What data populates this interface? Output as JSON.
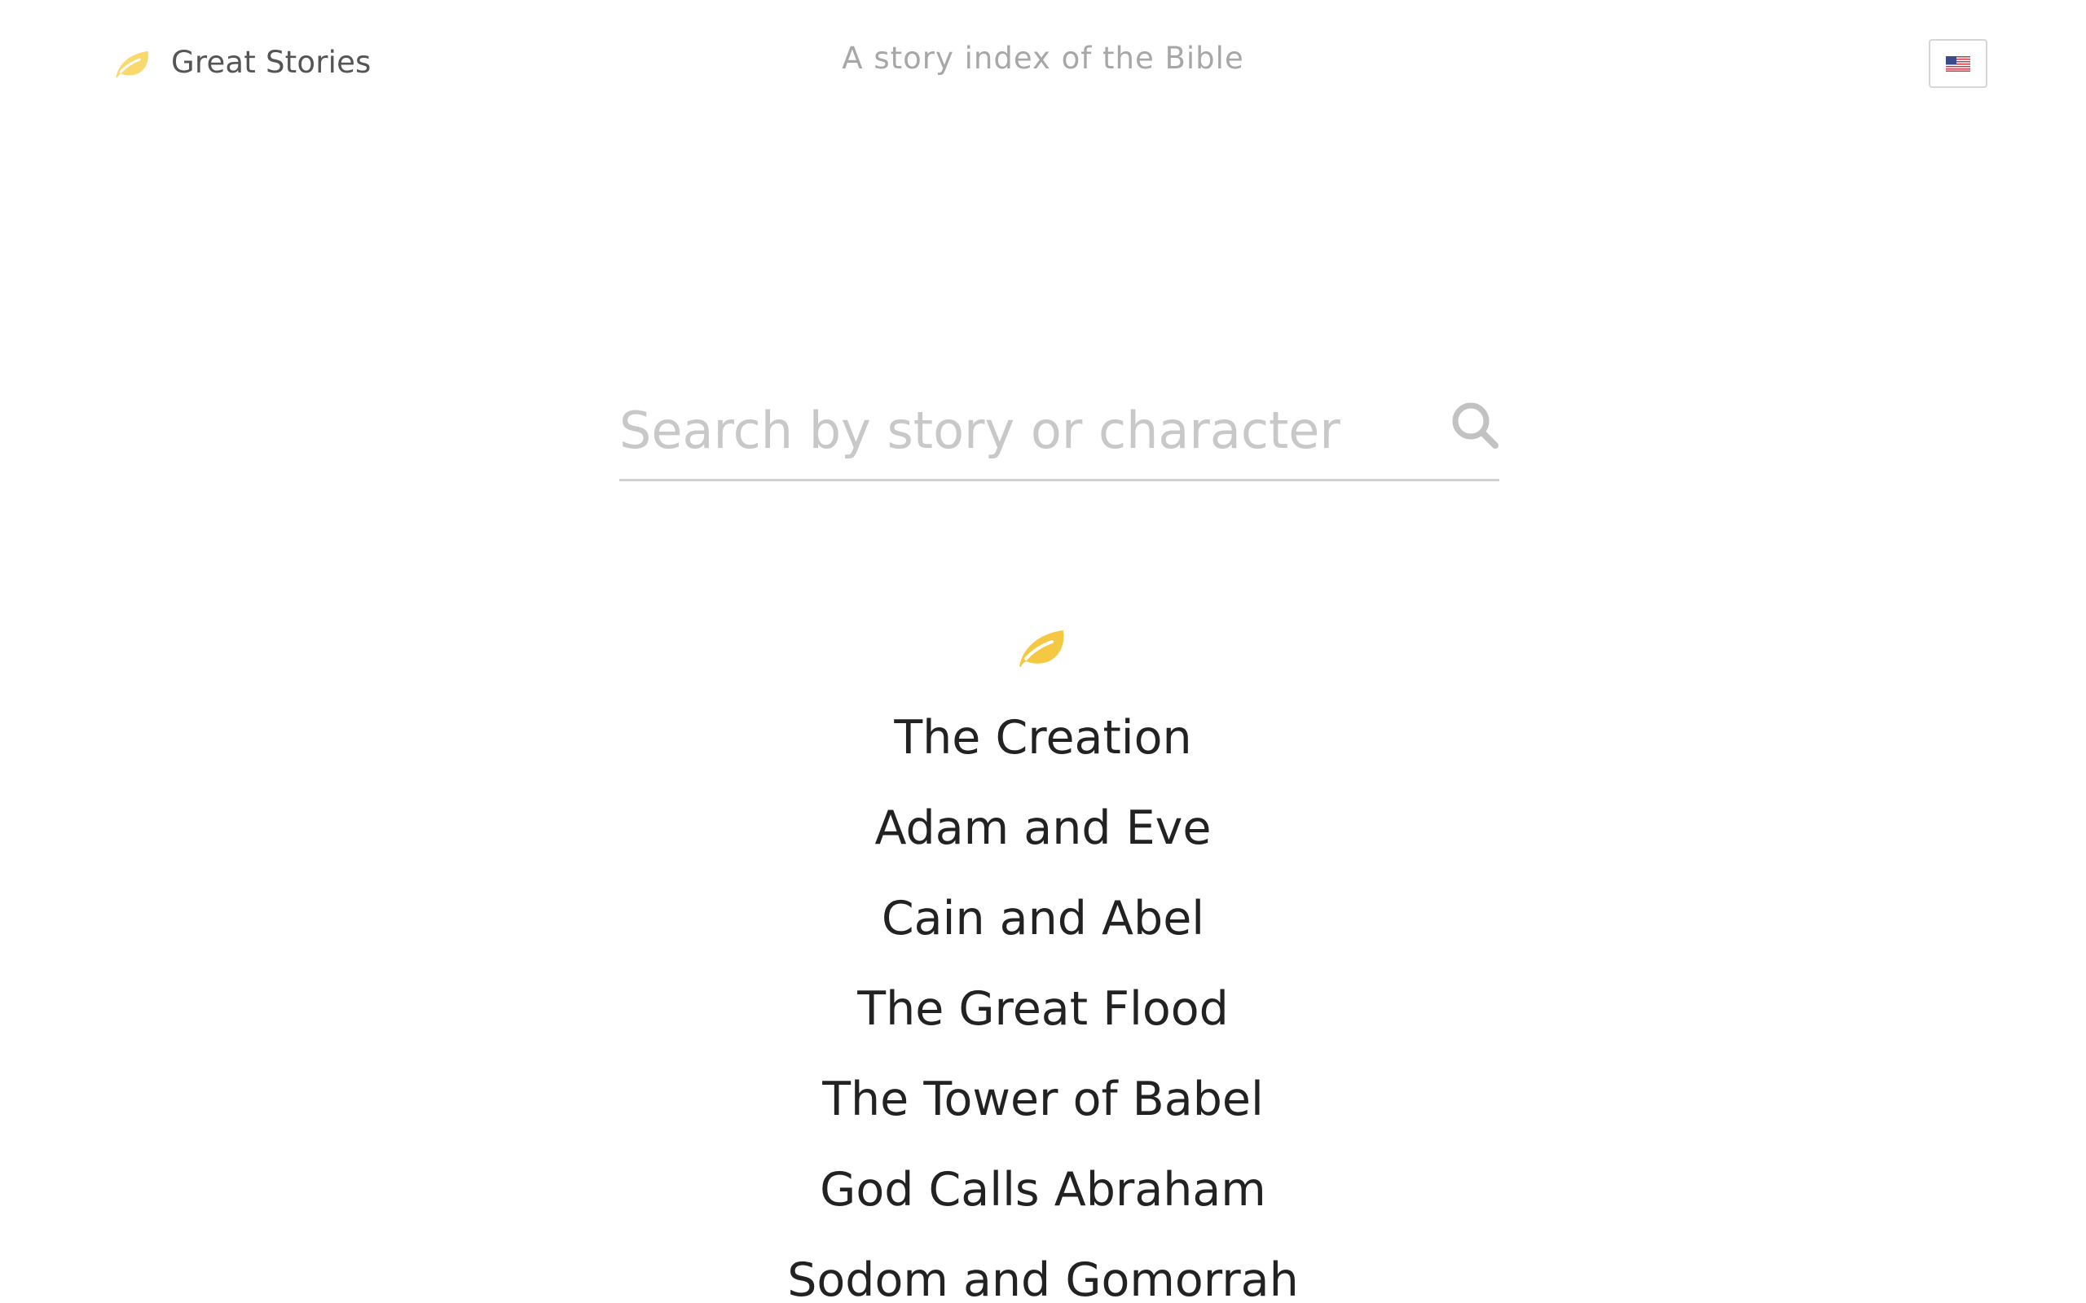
{
  "header": {
    "brand_name": "Great Stories",
    "brand_icon": "leaf-icon",
    "tagline": "A story index of the Bible",
    "language_icon": "us-flag-icon"
  },
  "search": {
    "placeholder": "Search by story or character",
    "value": "",
    "icon": "search-icon"
  },
  "divider_icon": "leaf-icon",
  "stories": [
    {
      "title": "The Creation"
    },
    {
      "title": "Adam and Eve"
    },
    {
      "title": "Cain and Abel"
    },
    {
      "title": "The Great Flood"
    },
    {
      "title": "The Tower of Babel"
    },
    {
      "title": "God Calls Abraham"
    },
    {
      "title": "Sodom and Gomorrah"
    }
  ],
  "colors": {
    "accent": "#F5C842",
    "accent_light": "#F9D96B",
    "text": "#222222",
    "muted": "#A7A7A7",
    "brand_text": "#555555"
  }
}
